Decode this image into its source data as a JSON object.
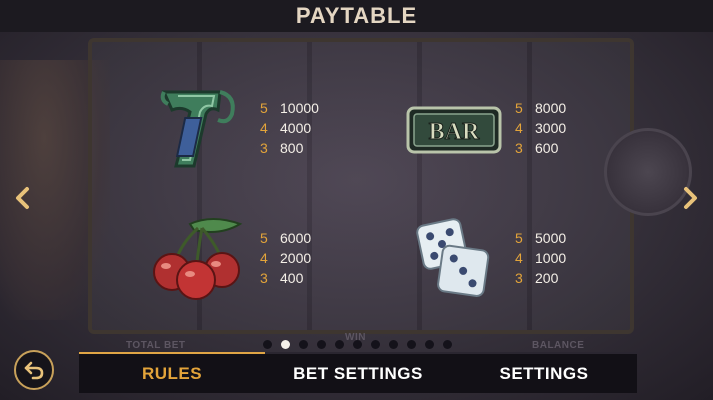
{
  "header": {
    "title": "PAYTABLE"
  },
  "background_labels": {
    "total_bet": "TOTAL BET",
    "win": "WIN",
    "balance": "BALANCE"
  },
  "symbols": [
    {
      "name": "seven",
      "icon": "seven-symbol-icon",
      "payouts": [
        {
          "count": "5",
          "value": "10000"
        },
        {
          "count": "4",
          "value": "4000"
        },
        {
          "count": "3",
          "value": "800"
        }
      ]
    },
    {
      "name": "bar",
      "icon": "bar-symbol-icon",
      "label": "BAR",
      "payouts": [
        {
          "count": "5",
          "value": "8000"
        },
        {
          "count": "4",
          "value": "3000"
        },
        {
          "count": "3",
          "value": "600"
        }
      ]
    },
    {
      "name": "cherries",
      "icon": "cherries-symbol-icon",
      "payouts": [
        {
          "count": "5",
          "value": "6000"
        },
        {
          "count": "4",
          "value": "2000"
        },
        {
          "count": "3",
          "value": "400"
        }
      ]
    },
    {
      "name": "dice",
      "icon": "dice-symbol-icon",
      "payouts": [
        {
          "count": "5",
          "value": "5000"
        },
        {
          "count": "4",
          "value": "1000"
        },
        {
          "count": "3",
          "value": "200"
        }
      ]
    }
  ],
  "pagination": {
    "total": 11,
    "current": 2
  },
  "tabs": [
    {
      "label": "RULES",
      "active": true
    },
    {
      "label": "BET SETTINGS",
      "active": false
    },
    {
      "label": "SETTINGS",
      "active": false
    }
  ],
  "colors": {
    "accent": "#e3a43a",
    "header_bg": "#1c1a20",
    "text": "#f4efe7"
  }
}
